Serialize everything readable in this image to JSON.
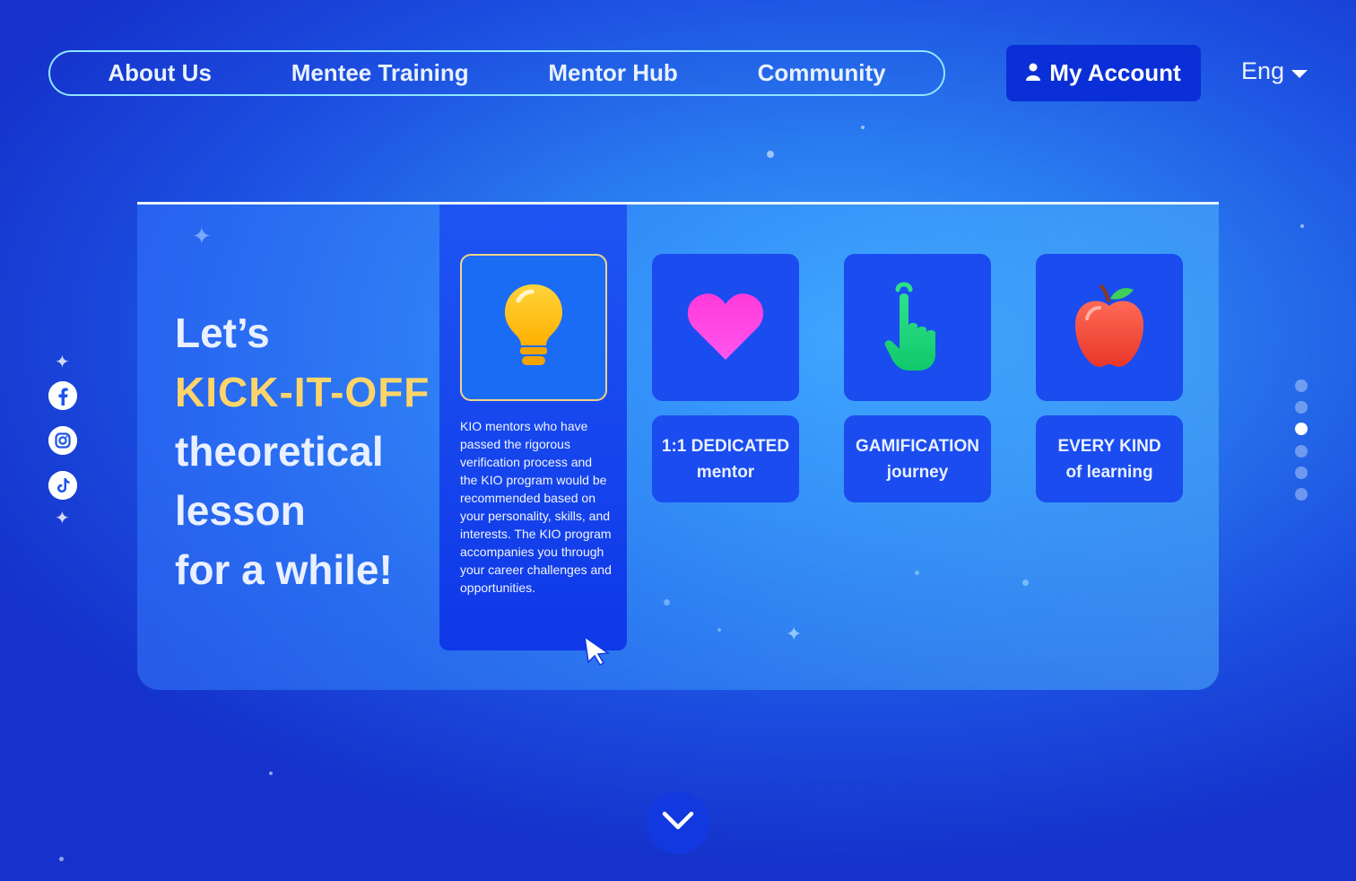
{
  "nav": {
    "links": [
      "About Us",
      "Mentee Training",
      "Mentor Hub",
      "Community"
    ],
    "account_label": "My Account",
    "language": "Eng"
  },
  "social": [
    "facebook-icon",
    "instagram-icon",
    "tiktok-icon"
  ],
  "hero": {
    "line1": "Let’s",
    "line2": "KICK-IT-OFF",
    "line3": "theoretical",
    "line4": "lesson",
    "line5": "for a while!"
  },
  "features": {
    "active": {
      "icon": "lightbulb-icon",
      "description": "KIO mentors who have passed the rigorous verification process and the KIO program would be recommended based on your personality, skills, and interests. The KIO program accompanies you through your career challenges and opportunities."
    },
    "items": [
      {
        "icon": "heart-icon",
        "title": "1:1 DEDICATED",
        "subtitle": "mentor"
      },
      {
        "icon": "pointing-hand-icon",
        "title": "GAMIFICATION",
        "subtitle": "journey"
      },
      {
        "icon": "apple-icon",
        "title": "EVERY KIND",
        "subtitle": "of learning"
      }
    ]
  },
  "pagination": {
    "total": 6,
    "active_index": 2
  },
  "colors": {
    "accent": "#ffd56a",
    "button": "#0b2fd6",
    "nav_border": "#8fe6ff"
  }
}
